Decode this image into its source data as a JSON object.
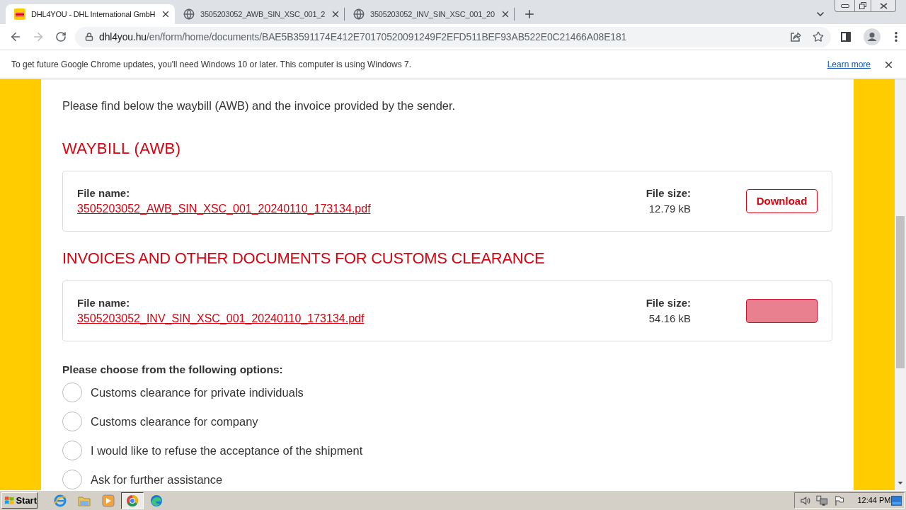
{
  "browser": {
    "tabs": [
      {
        "kind": "logo",
        "title": "DHL4YOU - DHL International GmbH",
        "selected": true
      },
      {
        "kind": "globe",
        "title": "3505203052_AWB_SIN_XSC_001_2",
        "selected": false
      },
      {
        "kind": "globe",
        "title": "3505203052_INV_SIN_XSC_001_20",
        "selected": false
      }
    ],
    "address_bar": {
      "host": "dhl4you.hu",
      "path": "/en/form/home/documents/BAE5B3591174E412E70170520091249F2EFD511BEF93AB522E0C21466A08E181"
    },
    "infobar": {
      "message": "To get future Google Chrome updates, you'll need Windows 10 or later. This computer is using Windows 7.",
      "link": "Learn more"
    }
  },
  "page": {
    "intro": "Please find below the waybill (AWB) and the invoice provided by the sender.",
    "sections": [
      {
        "heading": "WAYBILL (AWB)",
        "file": {
          "name_label": "File name:",
          "name": "3505203052_AWB_SIN_XSC_001_20240110_173134.pdf",
          "size_label": "File size:",
          "size": "12.79 kB",
          "button": {
            "label": "Download",
            "pressed": false
          }
        }
      },
      {
        "heading": "INVOICES AND OTHER DOCUMENTS FOR CUSTOMS CLEARANCE",
        "file": {
          "name_label": "File name:",
          "name": "3505203052_INV_SIN_XSC_001_20240110_173134.pdf",
          "size_label": "File size:",
          "size": "54.16 kB",
          "button": {
            "pressed": true
          }
        }
      }
    ],
    "options_prompt": "Please choose from the following options:",
    "options": [
      {
        "label": "Customs clearance for private individuals",
        "selected": false
      },
      {
        "label": "Customs clearance for company",
        "selected": false
      },
      {
        "label": "I would like to refuse the acceptance of the shipment",
        "selected": false
      },
      {
        "label": "Ask for further assistance",
        "selected": false
      }
    ]
  },
  "taskbar": {
    "start": "Start",
    "apps": [
      {
        "kind": "e-logo",
        "selected": false
      },
      {
        "kind": "folder",
        "selected": false
      },
      {
        "kind": "play",
        "selected": false
      },
      {
        "kind": "ring-logo",
        "selected": true
      },
      {
        "kind": "wave-logo",
        "selected": false
      }
    ],
    "clock": "12:44 PM"
  }
}
